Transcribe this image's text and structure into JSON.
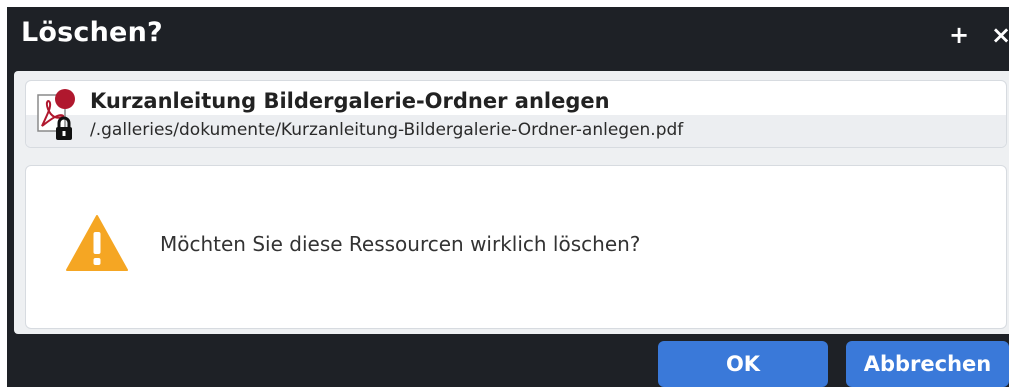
{
  "dialog": {
    "title": "Löschen?",
    "maximize_label": "+",
    "close_label": "×"
  },
  "resource": {
    "title": "Kurzanleitung Bildergalerie-Ordner anlegen",
    "path": "/.galleries/dokumente/Kurzanleitung-Bildergalerie-Ordner-anlegen.pdf",
    "icon": "pdf-file-icon",
    "overlay_icons": [
      "red-dot-icon",
      "lock-icon"
    ]
  },
  "message": {
    "text": "Möchten Sie diese Ressourcen wirklich löschen?",
    "icon": "warning-icon"
  },
  "buttons": {
    "ok_label": "OK",
    "cancel_label": "Abbrechen"
  },
  "colors": {
    "titlebar_bg": "#1e2126",
    "button_bg": "#3a79d9",
    "warning": "#f5a623",
    "pdf_red": "#b0182e"
  }
}
